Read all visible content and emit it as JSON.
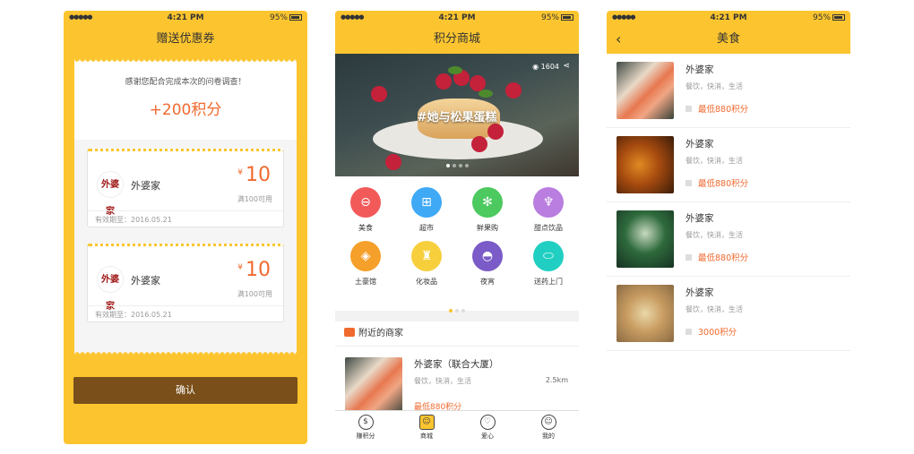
{
  "status_bar": {
    "signal": "●●●●●",
    "time": "4:21 PM",
    "battery": "95%"
  },
  "screen1": {
    "title": "赠送优惠券",
    "thanks": "感谢您配合完成本次的问卷调查！",
    "points_earned": "+200积分",
    "coupons": [
      {
        "logo": "外婆家",
        "merchant": "外婆家",
        "currency": "¥",
        "amount": "10",
        "condition": "满100可用",
        "validity": "有效期至：2016.05.21"
      },
      {
        "logo": "外婆家",
        "merchant": "外婆家",
        "currency": "¥",
        "amount": "10",
        "condition": "满100可用",
        "validity": "有效期至：2016.05.21"
      }
    ],
    "confirm": "确认"
  },
  "screen2": {
    "title": "积分商城",
    "banner": {
      "caption": "#她与松果蛋糕",
      "views": "1604"
    },
    "categories": [
      {
        "label": "美食",
        "icon": "bowl-icon",
        "glyph": "⊖",
        "color": "#f25a5a"
      },
      {
        "label": "超市",
        "icon": "cart-icon",
        "glyph": "⊞",
        "color": "#3fa9f5"
      },
      {
        "label": "鲜果购",
        "icon": "fruit-icon",
        "glyph": "✻",
        "color": "#4cc95f"
      },
      {
        "label": "甜点饮品",
        "icon": "wineglass-icon",
        "glyph": "♆",
        "color": "#b97ee0"
      },
      {
        "label": "土豪馆",
        "icon": "shield-icon",
        "glyph": "◈",
        "color": "#f5a02a"
      },
      {
        "label": "化妆品",
        "icon": "cosmetics-icon",
        "glyph": "♜",
        "color": "#f7cf3d"
      },
      {
        "label": "夜宵",
        "icon": "cloche-icon",
        "glyph": "◓",
        "color": "#7a5bc7"
      },
      {
        "label": "送药上门",
        "icon": "pill-icon",
        "glyph": "⬭",
        "color": "#21cfc2"
      }
    ],
    "nearby_title": "附近的商家",
    "nearby": {
      "name": "外婆家（联合大厦）",
      "tags": "餐饮，快消，生活",
      "distance": "2.5km",
      "points": "最低880积分"
    },
    "tabs": [
      {
        "label": "赚积分",
        "glyph": "$"
      },
      {
        "label": "商城",
        "glyph": "☺"
      },
      {
        "label": "爱心",
        "glyph": "♡"
      },
      {
        "label": "我的",
        "glyph": "☺"
      }
    ]
  },
  "screen3": {
    "title": "美食",
    "back": "‹",
    "items": [
      {
        "name": "外婆家",
        "tags": "餐饮，快消，生活",
        "points": "最低880积分"
      },
      {
        "name": "外婆家",
        "tags": "餐饮，快消，生活",
        "points": "最低880积分"
      },
      {
        "name": "外婆家",
        "tags": "餐饮，快消，生活",
        "points": "最低880积分"
      },
      {
        "name": "外婆家",
        "tags": "餐饮，快消，生活",
        "points": "3000积分"
      }
    ]
  },
  "colors": {
    "accent": "#fcc52f",
    "points": "#f06a2f",
    "confirm_button": "#7a4f1a"
  }
}
